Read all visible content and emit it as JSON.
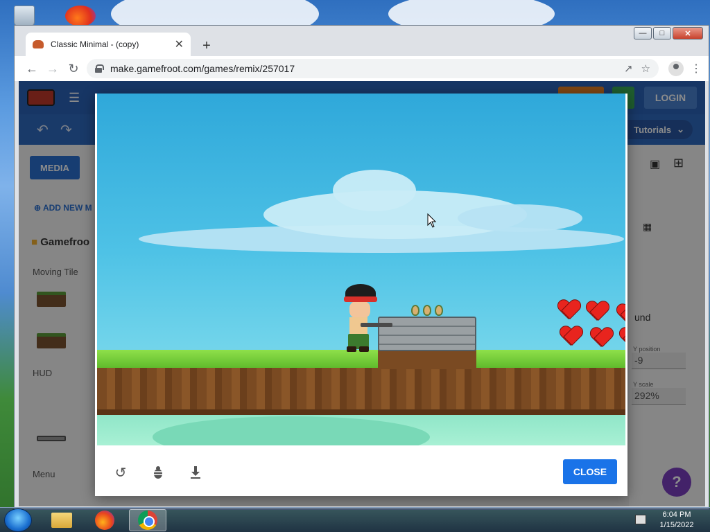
{
  "browser": {
    "tab_title": "Classic Minimal - (copy)",
    "url": "make.gamefroot.com/games/remix/257017"
  },
  "app": {
    "login_label": "LOGIN",
    "tutorials_label": "Tutorials",
    "media_label": "MEDIA",
    "add_new_label": "ADD NEW M",
    "folder_label": "Gamefroo",
    "categories": [
      "Moving Tile",
      "HUD",
      "Menu"
    ],
    "right_panel": {
      "dropdown_value": "und",
      "y_position_label": "Y position",
      "y_position_value": "-9",
      "y_scale_label": "Y scale",
      "y_scale_value": "292%"
    },
    "help_label": "?"
  },
  "modal": {
    "close_label": "CLOSE",
    "footer_icons": [
      "restart-icon",
      "bug-icon",
      "download-icon"
    ]
  },
  "taskbar": {
    "time": "6:04 PM",
    "date": "1/15/2022",
    "apps": [
      "file-explorer",
      "firefox",
      "chrome"
    ]
  }
}
